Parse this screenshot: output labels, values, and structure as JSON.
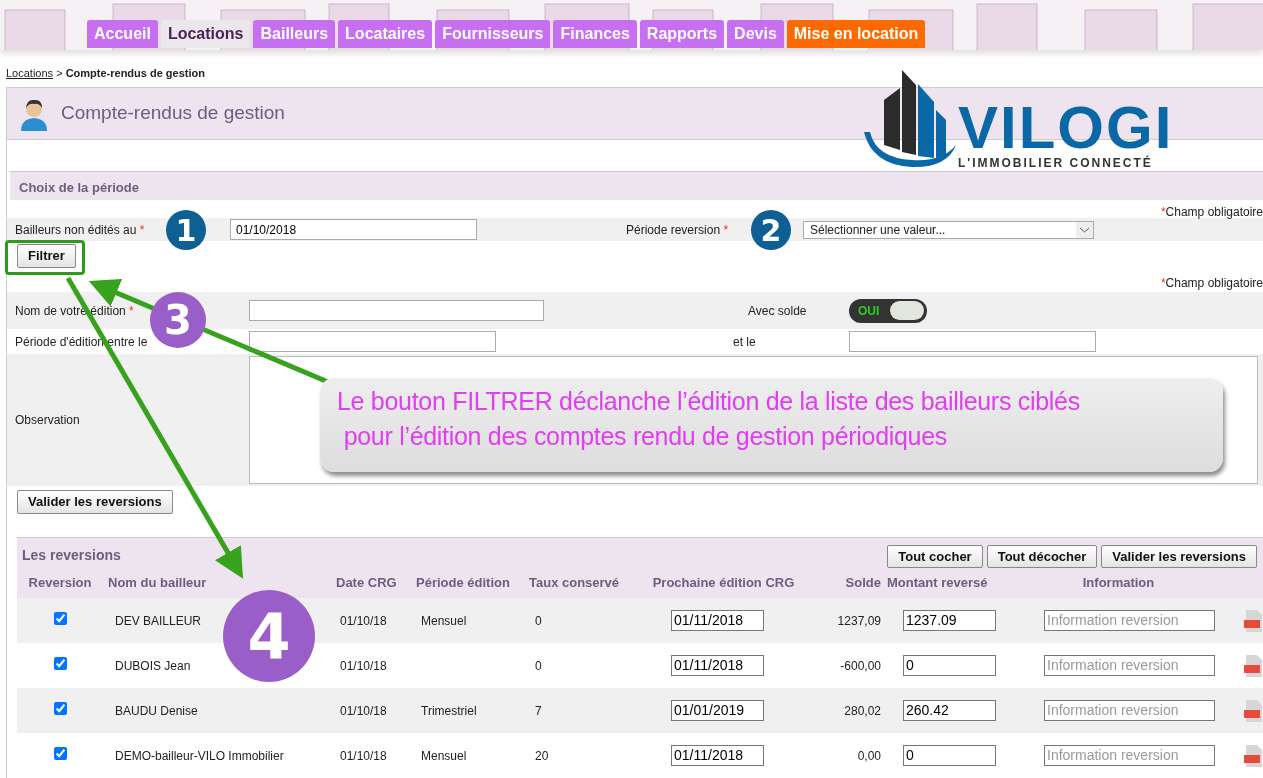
{
  "nav_tabs": [
    {
      "label": "Accueil",
      "selected": false,
      "kind": "normal"
    },
    {
      "label": "Locations",
      "selected": true,
      "kind": "normal"
    },
    {
      "label": "Bailleurs",
      "selected": false,
      "kind": "normal"
    },
    {
      "label": "Locataires",
      "selected": false,
      "kind": "normal"
    },
    {
      "label": "Fournisseurs",
      "selected": false,
      "kind": "normal"
    },
    {
      "label": "Finances",
      "selected": false,
      "kind": "normal"
    },
    {
      "label": "Rapports",
      "selected": false,
      "kind": "normal"
    },
    {
      "label": "Devis",
      "selected": false,
      "kind": "normal"
    },
    {
      "label": "Mise en location",
      "selected": false,
      "kind": "highlight"
    }
  ],
  "breadcrumb": {
    "link": "Locations",
    "separator": ">",
    "current": "Compte-rendus de gestion"
  },
  "page_title": "Compte-rendus de gestion",
  "logo": {
    "name": "VILOGI",
    "tagline": "L'IMMOBILIER CONNECTÉ"
  },
  "period_section": {
    "title": "Choix de la période",
    "note_mark": "*",
    "note": "Champ obligatoire",
    "fields": [
      {
        "label": "Bailleurs non édités au",
        "required_mark": "*",
        "kind": "text",
        "value": "01/10/2018"
      },
      {
        "label": "Période reversion",
        "required_mark": "*",
        "kind": "select",
        "value": "Sélectionner une valeur..."
      }
    ],
    "button": "Filtrer"
  },
  "edition_section": {
    "note_mark": "*",
    "note": "Champ obligatoire",
    "name_field": {
      "label": "Nom de votre édition",
      "required_mark": "*"
    },
    "balance_toggle": {
      "label": "Avec solde",
      "on": true,
      "state_text": "OUI"
    },
    "period_from": {
      "label": "Période d'édition entre le"
    },
    "period_to": {
      "label": "et le"
    },
    "observation": {
      "label": "Observation"
    },
    "button": "Valider les reversions"
  },
  "reversions": {
    "title": "Les reversions",
    "buttons": [
      "Tout cocher",
      "Tout décocher",
      "Valider les reversions"
    ],
    "columns": [
      "Reversion",
      "Nom du bailleur",
      "Date CRG",
      "Période édition",
      "Taux conservé",
      "Prochaine édition CRG",
      "Solde",
      "Montant reversé",
      "Information"
    ],
    "rows": [
      {
        "checked": true,
        "name": "DEV BAILLEUR",
        "date": "01/10/18",
        "period": "Mensuel",
        "rate": "0",
        "next": "01/11/2018",
        "balance": "1237,09",
        "amount": "1237.09",
        "info_placeholder": "Information reversion"
      },
      {
        "checked": true,
        "name": "DUBOIS Jean",
        "date": "01/10/18",
        "rate": "0",
        "next": "01/11/2018",
        "balance": "-600,00",
        "amount": "0",
        "info_placeholder": "Information reversion"
      },
      {
        "checked": true,
        "name": "BAUDU Denise",
        "date": "01/10/18",
        "period": "Trimestriel",
        "rate": "7",
        "next": "01/01/2019",
        "balance": "280,02",
        "amount": "260.42",
        "info_placeholder": "Information reversion"
      },
      {
        "checked": true,
        "name": "DEMO-bailleur-VILO Immobilier",
        "date": "01/10/18",
        "period": "Mensuel",
        "rate": "20",
        "next": "01/11/2018",
        "balance": "0,00",
        "amount": "0",
        "info_placeholder": "Information reversion"
      }
    ]
  },
  "annotations": {
    "badges": [
      {
        "number": "1",
        "color": "#0e5f94"
      },
      {
        "number": "2",
        "color": "#0e5f94"
      },
      {
        "number": "3",
        "color": "#9a5ec8"
      },
      {
        "number": "4",
        "color": "#9a5ec8"
      }
    ],
    "callout": [
      "Le bouton FILTRER déclanche l’édition de la liste des bailleurs ciblés",
      "pour l’édition des comptes rendu de gestion périodiques"
    ]
  }
}
